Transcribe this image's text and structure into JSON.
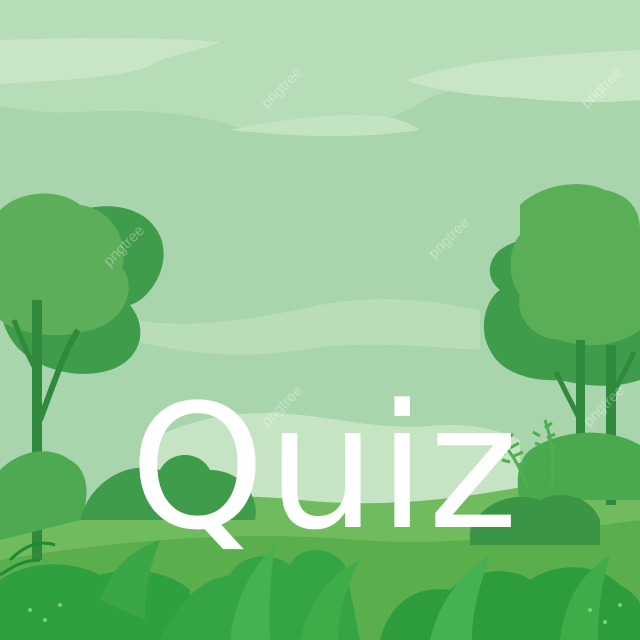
{
  "title": "Quiz",
  "watermark": "pngtree",
  "colors": {
    "sky": "#a8d4ac",
    "cloud": "#c4e4c4",
    "hill": "#69b85a",
    "tree_light": "#5cae5a",
    "tree_dark": "#3e9a4a",
    "foliage": "#2e9e3e",
    "title_text": "#ffffff"
  }
}
